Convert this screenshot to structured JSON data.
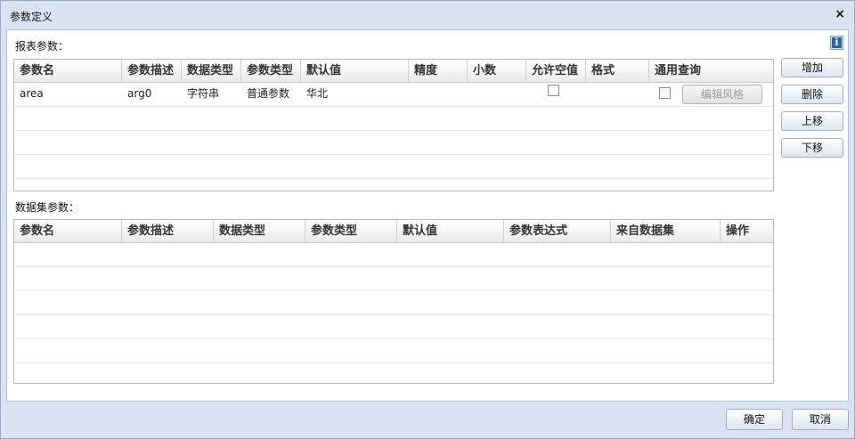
{
  "dialog": {
    "title": "参数定义",
    "close": "×"
  },
  "info_icon": "i",
  "report_params": {
    "label": "报表参数：",
    "columns": [
      "参数名",
      "参数描述",
      "数据类型",
      "参数类型",
      "默认值",
      "精度",
      "小数",
      "允许空值",
      "格式",
      "通用查询"
    ],
    "rows": [
      {
        "name": "area",
        "desc": "arg0",
        "data_type": "字符串",
        "param_type": "普通参数",
        "default": "华北",
        "precision": "",
        "decimal": "",
        "allow_null": false,
        "format": "",
        "general_query": false,
        "edit_style": "编辑风格"
      }
    ]
  },
  "dataset_params": {
    "label": "数据集参数：",
    "columns": [
      "参数名",
      "参数描述",
      "数据类型",
      "参数类型",
      "默认值",
      "参数表达式",
      "来自数据集",
      "操作"
    ],
    "rows": []
  },
  "side_buttons": {
    "add": "增加",
    "delete": "删除",
    "up": "上移",
    "down": "下移"
  },
  "footer": {
    "ok": "确定",
    "cancel": "取消"
  }
}
